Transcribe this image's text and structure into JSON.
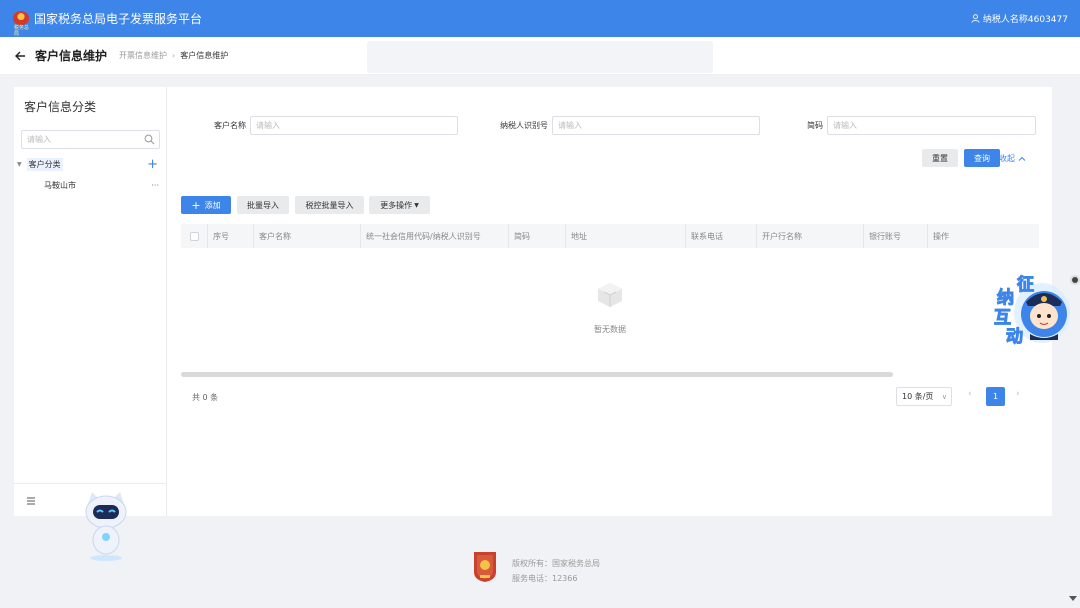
{
  "header": {
    "app_title": "国家税务总局电子发票服务平台",
    "emblem_tag": "税务总局",
    "user_name": "纳税人名称4603477"
  },
  "subheader": {
    "page_title": "客户信息维护",
    "breadcrumb": [
      "开票信息维护",
      "客户信息维护"
    ]
  },
  "sidebar": {
    "title": "客户信息分类",
    "search_placeholder": "请输入",
    "tree_root": "客户分类",
    "tree_children": [
      "马鞍山市"
    ]
  },
  "search_form": {
    "customer_name_label": "客户名称",
    "customer_name_placeholder": "请输入",
    "tax_id_label": "纳税人识别号",
    "tax_id_placeholder": "请输入",
    "short_name_label": "简码",
    "short_name_placeholder": "请输入",
    "reset_label": "重置",
    "query_label": "查询",
    "collapse_label": "收起"
  },
  "toolbar": {
    "add_label": "添加",
    "batch_import_label": "批量导入",
    "tax_batch_import_label": "税控批量导入",
    "more_label": "更多操作"
  },
  "table": {
    "columns": [
      "序号",
      "客户名称",
      "统一社会信用代码/纳税人识别号",
      "简码",
      "地址",
      "联系电话",
      "开户行名称",
      "银行账号",
      "操作"
    ],
    "empty_text": "暂无数据"
  },
  "pagination": {
    "total_text": "共 0 条",
    "page_size": "10 条/页",
    "current_page": "1"
  },
  "footer": {
    "copyright": "版权所有：国家税务总局",
    "service_phone": "服务电话：12366"
  },
  "mascot": {
    "chars": [
      "征",
      "纳",
      "互",
      "动"
    ]
  },
  "colors": {
    "primary": "#3d85e8",
    "header_bg": "#3d85e8",
    "page_bg": "#f0f2f5"
  }
}
